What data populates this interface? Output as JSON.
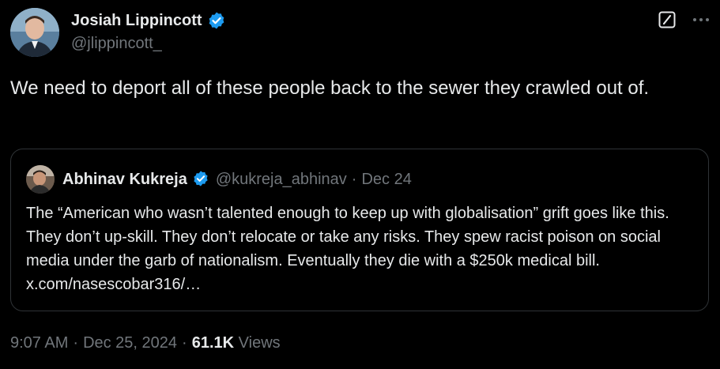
{
  "author": {
    "display_name": "Josiah Lippincott",
    "handle": "@jlippincott_",
    "verified": true
  },
  "post": {
    "text": "We need to deport all of these people back to the sewer they crawled out of."
  },
  "quoted_post": {
    "display_name": "Abhinav Kukreja",
    "handle": "@kukreja_abhinav",
    "separator": "·",
    "date": "Dec 24",
    "verified": true,
    "text": "The “American who wasn’t talented enough to keep up with globalisation” grift goes like this. They don’t up-skill. They don’t relocate or take any risks. They spew racist poison on social media under the garb of nationalism. Eventually they die with a $250k medical bill.",
    "link": "x.com/nasescobar316/…"
  },
  "meta": {
    "time": "9:07 AM",
    "sep1": "·",
    "date": "Dec 25, 2024",
    "sep2": "·",
    "views_count": "61.1K",
    "views_label": "Views"
  },
  "icons": {
    "verified": "verified-badge-icon",
    "grok": "grok-icon",
    "more": "more-icon"
  },
  "colors": {
    "background": "#000000",
    "text_primary": "#e7e9ea",
    "text_secondary": "#71767b",
    "verified_blue": "#1d9bf0",
    "border": "#2f3336"
  }
}
